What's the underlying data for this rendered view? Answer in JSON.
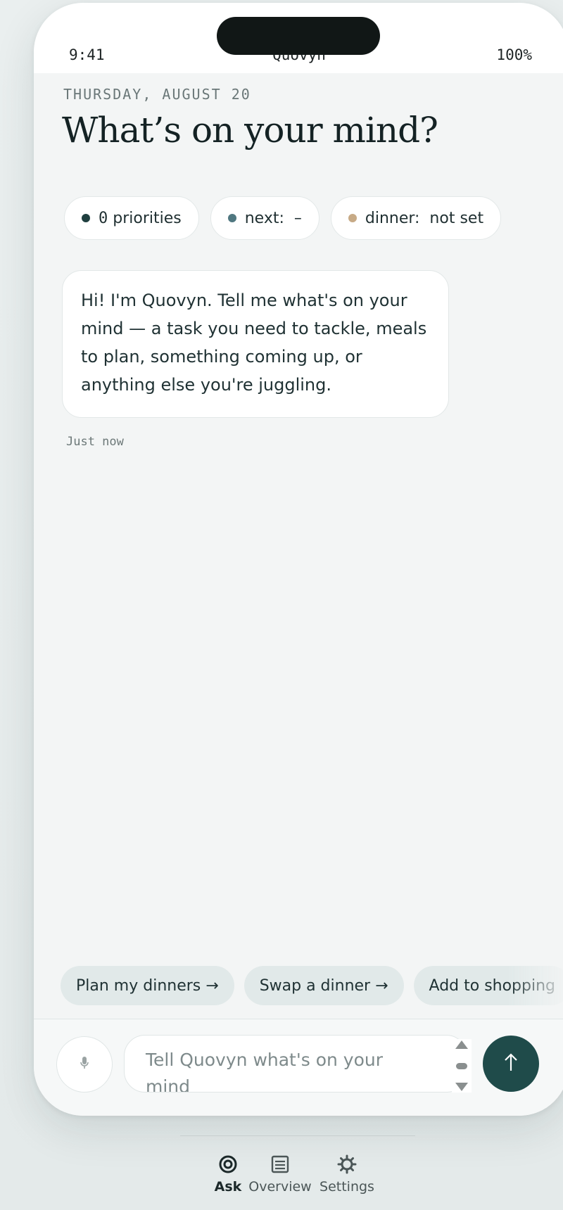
{
  "status_bar": {
    "time": "9:41",
    "app_name": "Quovyn",
    "battery": "100%"
  },
  "header": {
    "date": "THURSDAY, AUGUST 20",
    "title": "What’s on your mind?"
  },
  "chips": {
    "priorities_count": "0",
    "priorities_label": "priorities",
    "next": "next:  –",
    "dinner": "dinner:  not set"
  },
  "colors": {
    "priorities_dot": "#1f3f3f",
    "next_dot": "#4f7780",
    "dinner_dot": "#c7aa86",
    "send_button": "#1f4b4a"
  },
  "message": {
    "text": "Hi! I'm Quovyn. Tell me what's on your mind — a task you need to tackle, meals to plan, something coming up, or anything else you're juggling.",
    "timestamp": "Just now"
  },
  "suggestions": {
    "plan_dinners": "Plan my dinners →",
    "swap_dinner": "Swap a dinner →",
    "add_shopping": "Add to shopping"
  },
  "composer": {
    "placeholder": "Tell Quovyn what's on your mind",
    "mic_icon": "mic-icon",
    "send_icon": "arrow-up-icon"
  },
  "tabs": {
    "ask": "Ask",
    "overview": "Overview",
    "settings": "Settings"
  }
}
